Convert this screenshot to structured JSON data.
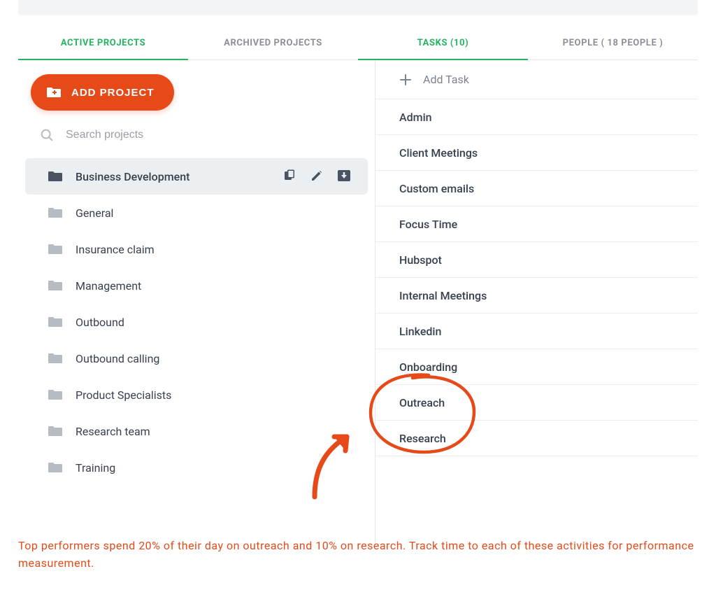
{
  "colors": {
    "accent_green": "#24b35f",
    "accent_orange": "#e64a19",
    "muted_gray": "#8a8f98",
    "text_dark": "#384150"
  },
  "tabs": {
    "active_projects": "ACTIVE PROJECTS",
    "archived_projects": "ARCHIVED PROJECTS",
    "tasks": "TASKS (10)",
    "people": "PEOPLE ( 18 PEOPLE )"
  },
  "add_project_label": "ADD PROJECT",
  "search_placeholder": "Search projects",
  "projects": [
    {
      "name": "Business Development",
      "selected": true
    },
    {
      "name": "General",
      "selected": false
    },
    {
      "name": "Insurance claim",
      "selected": false
    },
    {
      "name": "Management",
      "selected": false
    },
    {
      "name": "Outbound",
      "selected": false
    },
    {
      "name": "Outbound calling",
      "selected": false
    },
    {
      "name": "Product Specialists",
      "selected": false
    },
    {
      "name": "Research team",
      "selected": false
    },
    {
      "name": "Training",
      "selected": false
    }
  ],
  "add_task_label": "Add Task",
  "tasks_list": [
    "Admin",
    "Client Meetings",
    "Custom emails",
    "Focus Time",
    "Hubspot",
    "Internal Meetings",
    "Linkedin",
    "Onboarding",
    "Outreach",
    "Research"
  ],
  "caption": "Top performers spend 20% of their day on outreach and 10% on research. Track time to each of these activities for performance measurement."
}
